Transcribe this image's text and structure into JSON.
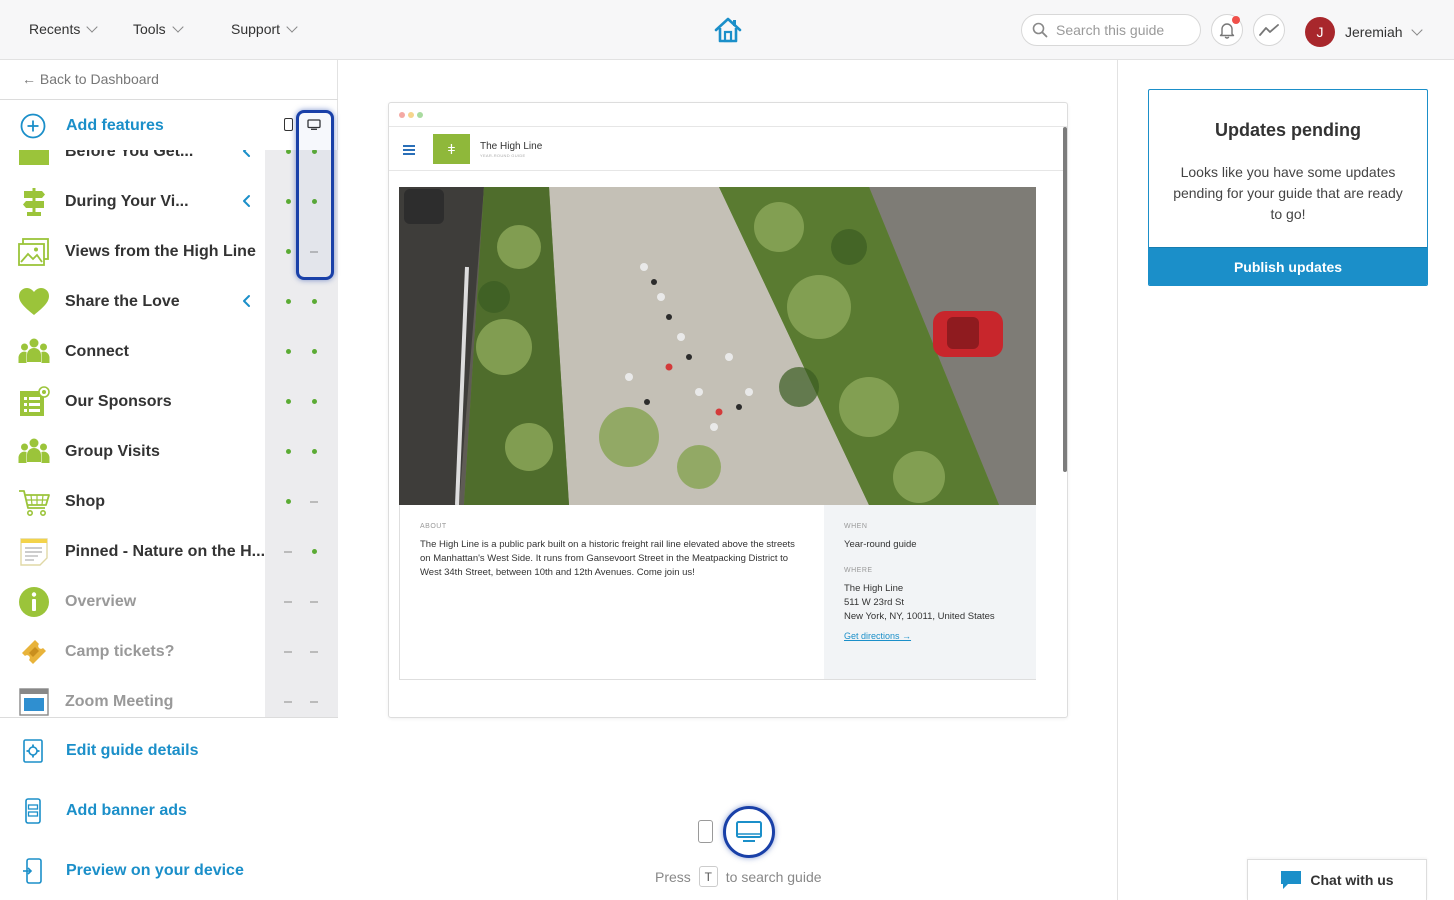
{
  "topbar": {
    "nav": [
      {
        "label": "Recents"
      },
      {
        "label": "Tools"
      },
      {
        "label": "Support"
      }
    ],
    "search_placeholder": "Search this guide",
    "user": {
      "initial": "J",
      "name": "Jeremiah"
    }
  },
  "sidebar": {
    "back_label": "← Back to Dashboard",
    "add_features_label": "Add features",
    "features": [
      {
        "label": "Before You Get...",
        "icon": "folder-icon",
        "expandable": true,
        "mobile": true,
        "desktop": true
      },
      {
        "label": "During Your Vi...",
        "icon": "signpost-icon",
        "expandable": true,
        "mobile": true,
        "desktop": true
      },
      {
        "label": "Views from the High Line",
        "icon": "image-icon",
        "expandable": false,
        "mobile": true,
        "desktop": false
      },
      {
        "label": "Share the Love",
        "icon": "heart-icon",
        "expandable": true,
        "mobile": true,
        "desktop": true
      },
      {
        "label": "Connect",
        "icon": "people-icon",
        "expandable": false,
        "mobile": true,
        "desktop": true
      },
      {
        "label": "Our Sponsors",
        "icon": "sponsors-icon",
        "expandable": false,
        "mobile": true,
        "desktop": true
      },
      {
        "label": "Group Visits",
        "icon": "group-icon",
        "expandable": false,
        "mobile": true,
        "desktop": true
      },
      {
        "label": "Shop",
        "icon": "cart-icon",
        "expandable": false,
        "mobile": true,
        "desktop": false
      },
      {
        "label": "Pinned - Nature on the H...",
        "icon": "notes-icon",
        "expandable": false,
        "mobile": false,
        "desktop": true
      },
      {
        "label": "Overview",
        "icon": "info-icon",
        "expandable": false,
        "mobile": false,
        "desktop": false,
        "muted": true
      },
      {
        "label": "Camp tickets?",
        "icon": "ticket-icon",
        "expandable": false,
        "mobile": false,
        "desktop": false,
        "muted": true
      },
      {
        "label": "Zoom Meeting",
        "icon": "window-icon",
        "expandable": false,
        "mobile": false,
        "desktop": false,
        "muted": true
      }
    ],
    "bottom_links": [
      {
        "label": "Edit guide details",
        "icon": "gear-doc-icon"
      },
      {
        "label": "Add banner ads",
        "icon": "phone-ad-icon"
      },
      {
        "label": "Preview on your device",
        "icon": "phone-preview-icon"
      }
    ]
  },
  "preview": {
    "guide_title": "The High Line",
    "guide_subtitle": "YEAR-ROUND GUIDE",
    "about_heading": "ABOUT",
    "about_text": "The High Line is a public park built on a historic freight rail line elevated above the streets on Manhattan's West Side. It runs from Gansevoort Street in the Meatpacking District to West 34th Street, between 10th and 12th Avenues. Come join us!",
    "when_heading": "WHEN",
    "when_text": "Year-round guide",
    "where_heading": "WHERE",
    "where_lines": [
      "The High Line",
      "511 W 23rd St",
      "New York, NY, 10011, United States"
    ],
    "directions_label": "Get directions →"
  },
  "device_toggle": {
    "press_label": "Press",
    "key": "T",
    "hint": "to search guide"
  },
  "updates": {
    "title": "Updates pending",
    "text": "Looks like you have some updates pending for your guide that are ready to go!",
    "button": "Publish updates"
  },
  "chat": {
    "label": "Chat with us"
  },
  "colors": {
    "accent": "#1b8fc9",
    "feature_green": "#9bc43a",
    "status_green": "#5bab34",
    "highlight": "#1940a8"
  }
}
